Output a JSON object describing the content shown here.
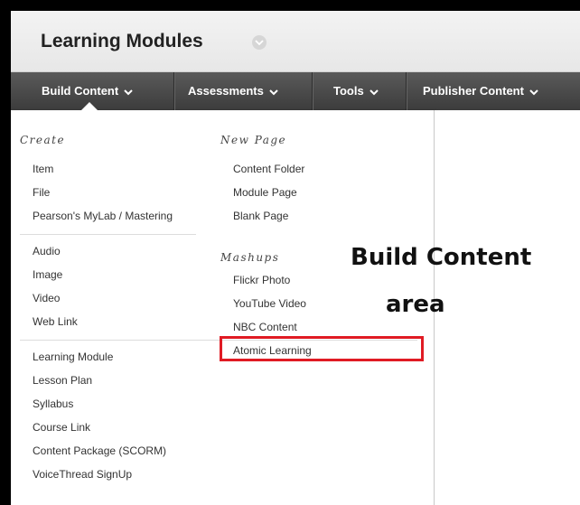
{
  "page": {
    "title": "Learning Modules"
  },
  "nav": {
    "items": [
      {
        "label": "Build Content"
      },
      {
        "label": "Assessments"
      },
      {
        "label": "Tools"
      },
      {
        "label": "Publisher Content"
      }
    ]
  },
  "menu": {
    "create_heading": "Create",
    "create_group1": [
      "Item",
      "File",
      "Pearson's MyLab / Mastering"
    ],
    "create_group2": [
      "Audio",
      "Image",
      "Video",
      "Web Link"
    ],
    "create_group3": [
      "Learning Module",
      "Lesson Plan",
      "Syllabus",
      "Course Link",
      "Content Package (SCORM)",
      "VoiceThread SignUp"
    ],
    "newpage_heading": "New Page",
    "newpage_items": [
      "Content Folder",
      "Module Page",
      "Blank Page"
    ],
    "mashups_heading": "Mashups",
    "mashups_items": [
      "Flickr Photo",
      "YouTube Video",
      "NBC Content",
      "Atomic Learning"
    ]
  },
  "annotation": {
    "line1": "Build Content",
    "line2": "area"
  },
  "colors": {
    "highlight": "#e01b24",
    "navbar": "#4a4a4a"
  }
}
